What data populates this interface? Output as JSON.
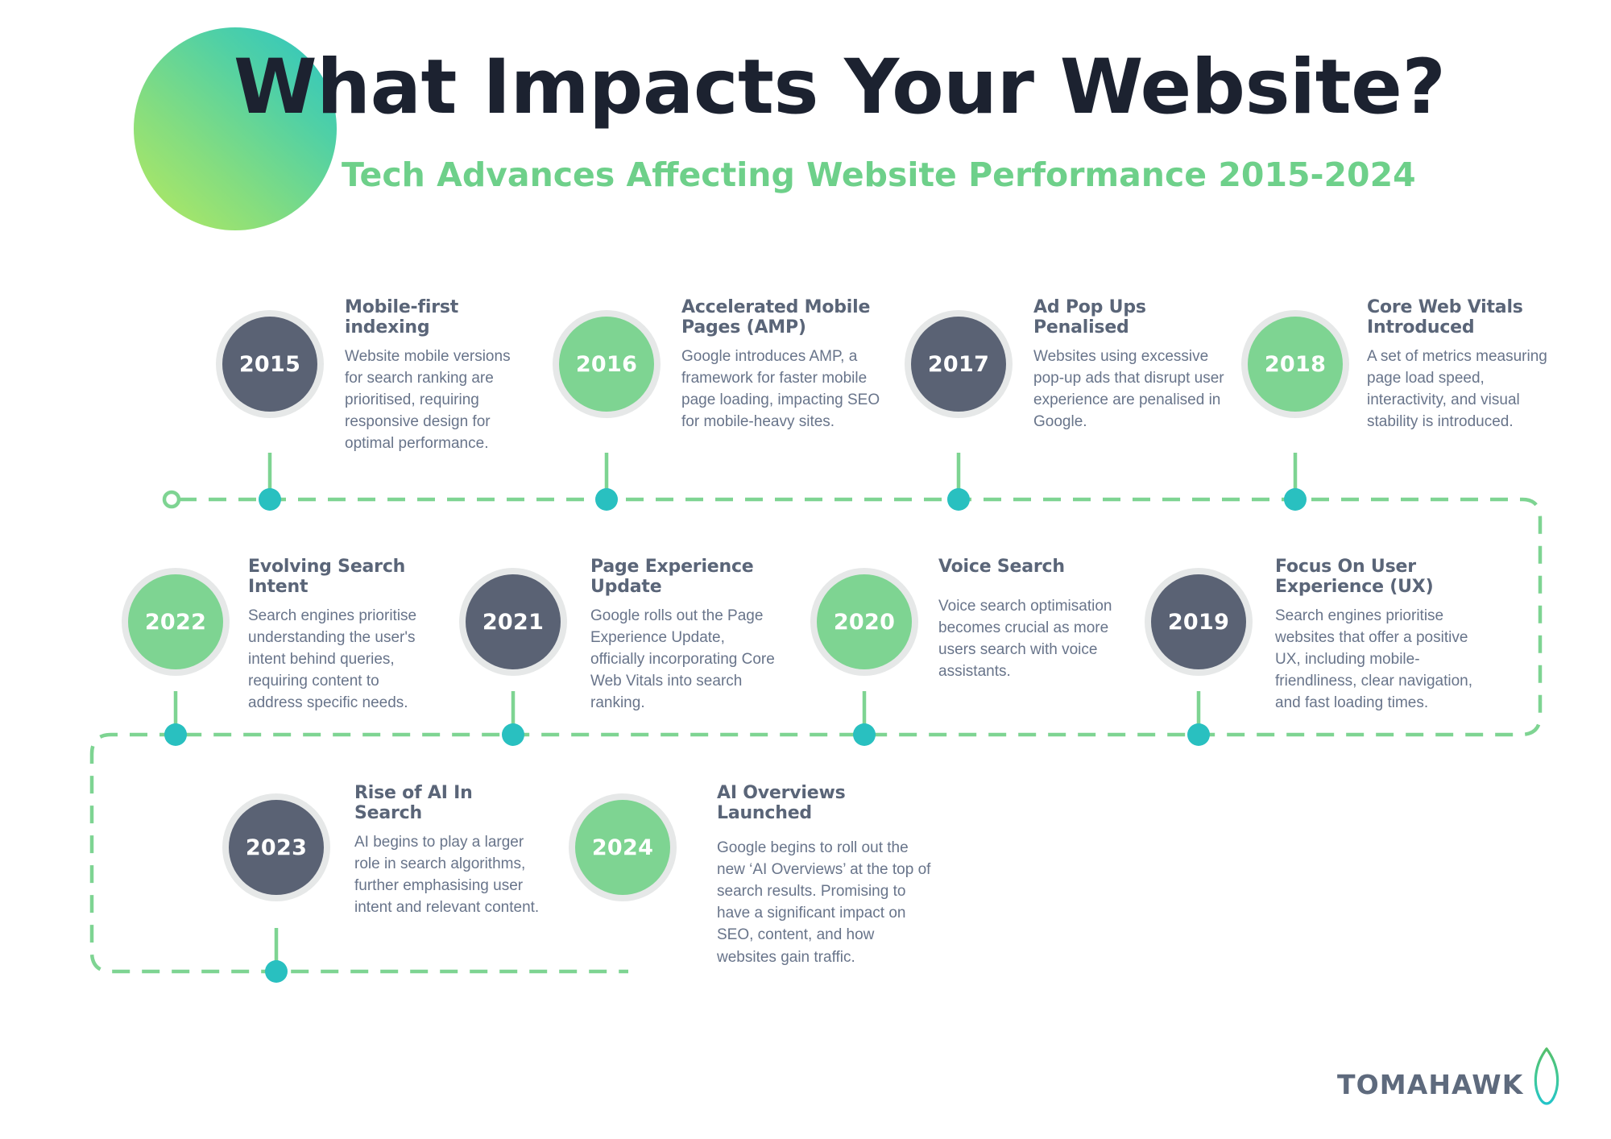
{
  "header": {
    "title": "What Impacts Your Website?",
    "subtitle": "Tech Advances Affecting Website Performance 2015-2024",
    "blob_gradient_from": "#b7ea5e",
    "blob_gradient_to": "#2cc4c4"
  },
  "colors": {
    "title_text": "#1c2230",
    "subtitle_text": "#6ed08a",
    "node_title_text": "#5a6578",
    "node_body_text": "#68748a",
    "bubble_dark": "#5a6274",
    "bubble_green": "#7ed492",
    "bubble_ring": "#e6e8e8",
    "connector_line": "#7ed492",
    "connector_dot": "#29c0c0",
    "background": "#ffffff",
    "logo_text": "#5e6a7d"
  },
  "timeline": {
    "rows": [
      {
        "row": 1,
        "items": [
          {
            "year": "2015",
            "bubble_style": "dark",
            "title": "Mobile-first indexing",
            "body": "Website mobile versions for search ranking are prioritised, requiring responsive design for optimal performance."
          },
          {
            "year": "2016",
            "bubble_style": "green",
            "title": "Accelerated Mobile Pages (AMP)",
            "body": "Google introduces AMP, a framework for faster mobile page loading, impacting SEO for mobile-heavy sites."
          },
          {
            "year": "2017",
            "bubble_style": "dark",
            "title": "Ad Pop Ups Penalised",
            "body": "Websites using excessive pop-up ads that disrupt user experience are penalised in Google."
          },
          {
            "year": "2018",
            "bubble_style": "green",
            "title": "Core Web Vitals Introduced",
            "body": "A set of metrics measuring page load speed, interactivity, and visual stability is introduced."
          }
        ]
      },
      {
        "row": 2,
        "items": [
          {
            "year": "2022",
            "bubble_style": "green",
            "title": "Evolving Search Intent",
            "body": "Search engines prioritise understanding the user's intent behind queries, requiring content to address specific needs."
          },
          {
            "year": "2021",
            "bubble_style": "dark",
            "title": "Page Experience Update",
            "body": "Google rolls out the Page Experience Update, officially incorporating Core Web Vitals into search ranking."
          },
          {
            "year": "2020",
            "bubble_style": "green",
            "title": "Voice Search",
            "body": "Voice search optimisation becomes crucial as more users search with voice assistants."
          },
          {
            "year": "2019",
            "bubble_style": "dark",
            "title": "Focus On User Experience (UX)",
            "body": "Search engines prioritise websites that offer a positive UX, including mobile-friendliness, clear navigation, and fast loading times."
          }
        ]
      },
      {
        "row": 3,
        "items": [
          {
            "year": "2023",
            "bubble_style": "dark",
            "title": "Rise of AI In Search",
            "body": "AI begins to play a larger role in search algorithms, further emphasising user intent and relevant content."
          },
          {
            "year": "2024",
            "bubble_style": "green",
            "title": "AI Overviews Launched",
            "body": "Google begins to roll out the new ‘AI Overviews’ at the top of search results. Promising to have a significant impact on SEO, content, and how websites gain traffic."
          }
        ]
      }
    ]
  },
  "footer": {
    "logo_text": "TOMAHAWK",
    "logo_icon": "feather-icon"
  }
}
